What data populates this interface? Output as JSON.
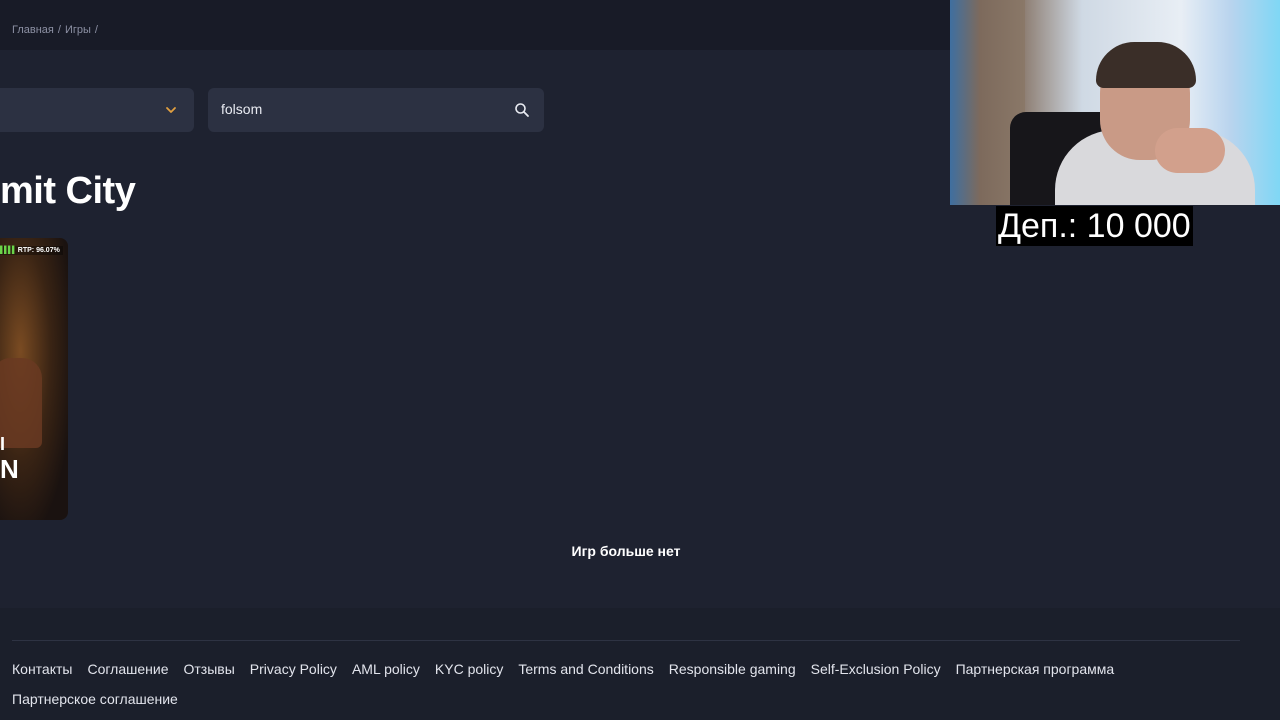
{
  "breadcrumb": {
    "items": [
      "Главная",
      "/",
      "Игры",
      "/"
    ]
  },
  "filters": {
    "provider_select_value": "",
    "search_value": "folsom"
  },
  "provider": {
    "title": "mit City"
  },
  "game_card": {
    "rtp_label": "RTP: 96.07%",
    "title_fragment_1": "I",
    "title_fragment_2": "N"
  },
  "status": {
    "no_more_games": "Игр больше нет"
  },
  "footer": {
    "links": [
      "Контакты",
      "Соглашение",
      "Отзывы",
      "Privacy Policy",
      "AML policy",
      "KYC policy",
      "Terms and Conditions",
      "Responsible gaming",
      "Self-Exclusion Policy",
      "Партнерская программа",
      "Партнерское соглашение"
    ]
  },
  "overlay": {
    "deposit_text": "Деп.: 10 000"
  },
  "colors": {
    "background": "#1e2230",
    "topbar": "#181b27",
    "input_bg": "#2c3142",
    "accent_chevron": "#e2a040",
    "rtp_bars": "#6bd44a"
  }
}
